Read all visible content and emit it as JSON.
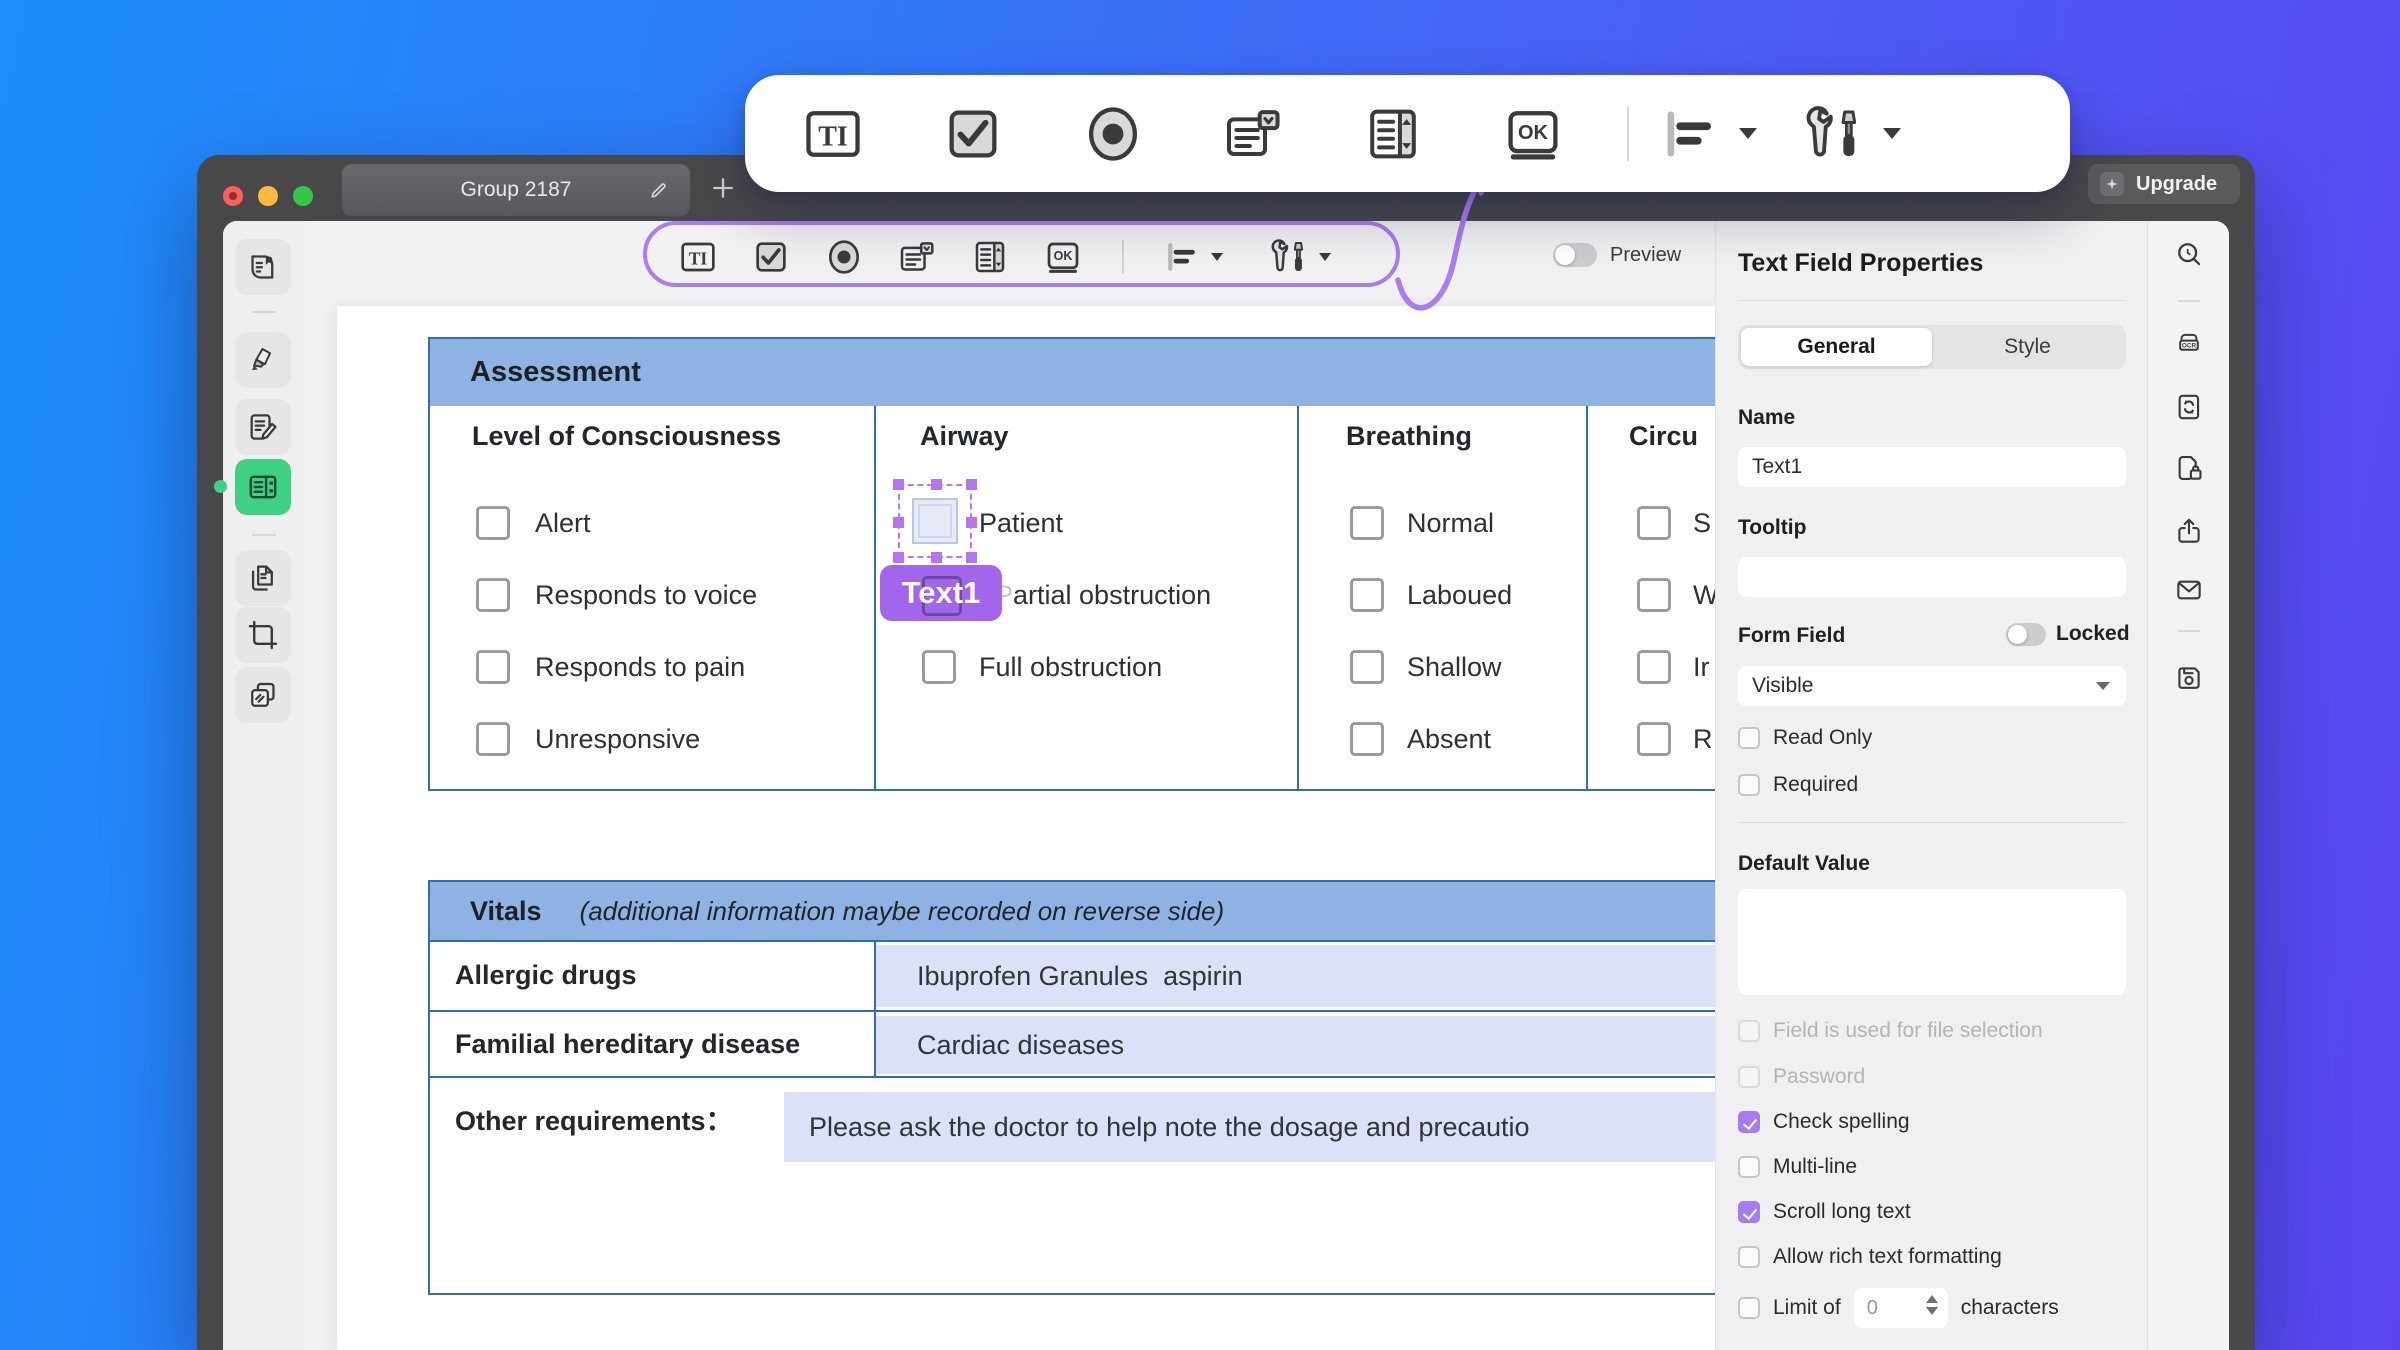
{
  "icons": {
    "text_field_glyph": "TI",
    "push_button_glyph": "OK",
    "ocr_glyph": "OCR"
  },
  "window": {
    "tab_title": "Group 2187",
    "upgrade_label": "Upgrade"
  },
  "toolbar": {
    "preview_label": "Preview"
  },
  "document": {
    "assessment": {
      "title": "Assessment",
      "columns": [
        {
          "header": "Level of Consciousness",
          "options": [
            "Alert",
            "Responds to voice",
            "Responds to pain",
            "Unresponsive"
          ]
        },
        {
          "header": "Airway",
          "options": [
            "Patient",
            "Partial obstruction",
            "Full obstruction"
          ]
        },
        {
          "header": "Breathing",
          "options": [
            "Normal",
            "Laboued",
            "Shallow",
            "Absent"
          ]
        },
        {
          "header": "Circu",
          "options": [
            "S",
            "W",
            "Ir",
            "R"
          ]
        }
      ],
      "selected_field_name": "Text1"
    },
    "vitals": {
      "title": "Vitals",
      "subtitle": "(additional information maybe recorded on reverse side)",
      "rows": [
        {
          "label": "Allergic drugs",
          "value": "Ibuprofen Granules  aspirin"
        },
        {
          "label": "Familial hereditary disease",
          "value": "Cardiac diseases"
        },
        {
          "label": "Other requirements：",
          "value": "Please ask the doctor to help note the dosage and precautio"
        }
      ]
    }
  },
  "panel": {
    "title": "Text Field Properties",
    "tabs": [
      "General",
      "Style"
    ],
    "active_tab": "General",
    "name_label": "Name",
    "name_value": "Text1",
    "tooltip_label": "Tooltip",
    "tooltip_value": "",
    "form_field_label": "Form Field",
    "locked_label": "Locked",
    "visibility_value": "Visible",
    "read_only_label": "Read Only",
    "required_label": "Required",
    "default_value_label": "Default Value",
    "default_value": "",
    "options": [
      {
        "label": "Field is used for file selection",
        "checked": false,
        "disabled": true
      },
      {
        "label": "Password",
        "checked": false,
        "disabled": true
      },
      {
        "label": "Check spelling",
        "checked": true,
        "disabled": false
      },
      {
        "label": "Multi-line",
        "checked": false,
        "disabled": false
      },
      {
        "label": "Scroll long text",
        "checked": true,
        "disabled": false
      },
      {
        "label": "Allow rich text formatting",
        "checked": false,
        "disabled": false
      }
    ],
    "limit_label": "Limit of",
    "limit_value": "0",
    "limit_suffix": "characters"
  },
  "colors": {
    "accent_purple": "#a87cf2",
    "badge_purple": "#a266ec",
    "active_green": "#3fd183",
    "table_header_blue": "#8eb2e2",
    "table_border_blue": "#2f6db5",
    "field_fill_blue": "#dbe2f7"
  }
}
